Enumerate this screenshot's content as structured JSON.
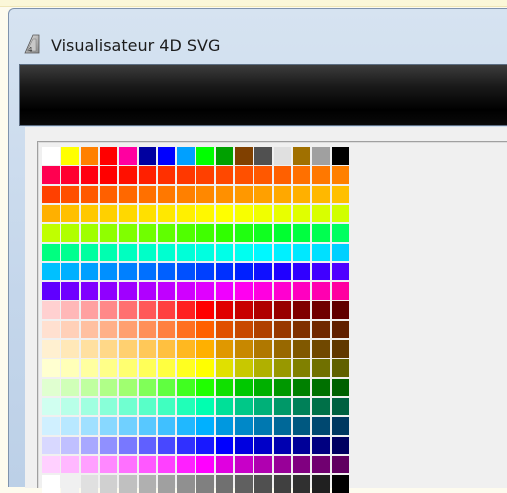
{
  "window": {
    "title": "Visualisateur 4D SVG",
    "icon": "4d-app-icon"
  },
  "palette": {
    "header_row": [
      "#ffffff",
      "#ffff00",
      "#ff8000",
      "#ff0000",
      "#ff00a0",
      "#0000a0",
      "#0000ff",
      "#00a0ff",
      "#00ff00",
      "#00a000",
      "#804000",
      "#505050",
      "#e0e0e0",
      "#a07000",
      "#a0a0a0",
      "#000000"
    ],
    "rows": [
      [
        "#ff0050",
        "#ff0030",
        "#ff0010",
        "#ff0000",
        "#ff1000",
        "#ff2000",
        "#ff3000",
        "#ff3800",
        "#ff4000",
        "#ff4800",
        "#ff5000",
        "#ff5800",
        "#ff6000",
        "#ff7000",
        "#ff7800",
        "#ff8000"
      ],
      [
        "#ff4000",
        "#ff5000",
        "#ff5800",
        "#ff6000",
        "#ff6800",
        "#ff7000",
        "#ff7800",
        "#ff8000",
        "#ff8800",
        "#ff9000",
        "#ff9800",
        "#ffa000",
        "#ffa800",
        "#ffb000",
        "#ffb800",
        "#ffc000"
      ],
      [
        "#ffb000",
        "#ffc000",
        "#ffc800",
        "#ffd000",
        "#ffd800",
        "#ffe000",
        "#ffe800",
        "#fff000",
        "#fff800",
        "#ffff00",
        "#f8ff00",
        "#f0ff00",
        "#e8ff00",
        "#e0ff00",
        "#d8ff00",
        "#d0ff00"
      ],
      [
        "#c0ff00",
        "#b0ff00",
        "#a0ff00",
        "#90ff00",
        "#80ff00",
        "#70ff00",
        "#60ff00",
        "#50ff00",
        "#40ff00",
        "#30ff00",
        "#20ff10",
        "#10ff20",
        "#00ff30",
        "#00ff40",
        "#00ff50",
        "#00ff60"
      ],
      [
        "#00ff80",
        "#00ff90",
        "#00ffa0",
        "#00ffb0",
        "#00ffc0",
        "#00ffc8",
        "#00ffd0",
        "#00ffd8",
        "#00ffe0",
        "#00ffe8",
        "#00fff0",
        "#00f8ff",
        "#00f0ff",
        "#00e8ff",
        "#00e0ff",
        "#00d0ff"
      ],
      [
        "#00c0ff",
        "#00b0ff",
        "#00a0ff",
        "#0090ff",
        "#0080ff",
        "#0070ff",
        "#0060ff",
        "#0050ff",
        "#0040ff",
        "#0030ff",
        "#0020ff",
        "#1010ff",
        "#2000ff",
        "#3000ff",
        "#4000ff",
        "#5000ff"
      ],
      [
        "#6000ff",
        "#7000ff",
        "#8000ff",
        "#9000ff",
        "#a000ff",
        "#b000ff",
        "#c000ff",
        "#d000ff",
        "#e000ff",
        "#f000ff",
        "#ff00f0",
        "#ff00e0",
        "#ff00d0",
        "#ff00c0",
        "#ff00b0",
        "#ff00a0"
      ],
      [
        "#ffd0d0",
        "#ffb8b8",
        "#ffa0a0",
        "#ff8888",
        "#ff7070",
        "#ff5858",
        "#ff4040",
        "#ff2020",
        "#ff0000",
        "#e00000",
        "#c80000",
        "#b00000",
        "#980000",
        "#800000",
        "#700000",
        "#600000"
      ],
      [
        "#ffe0d0",
        "#ffd0b8",
        "#ffc0a0",
        "#ffb088",
        "#ffa070",
        "#ff9058",
        "#ff8040",
        "#ff7020",
        "#ff6000",
        "#e05000",
        "#c84800",
        "#b04000",
        "#983800",
        "#803000",
        "#702800",
        "#602000"
      ],
      [
        "#fff0d0",
        "#ffe8b8",
        "#ffe0a0",
        "#ffd888",
        "#ffd070",
        "#ffc858",
        "#ffc040",
        "#ffb820",
        "#ffb000",
        "#e09800",
        "#c88800",
        "#b07800",
        "#986800",
        "#805800",
        "#704800",
        "#603800"
      ],
      [
        "#ffffd0",
        "#ffffb8",
        "#ffffa0",
        "#ffff88",
        "#ffff70",
        "#ffff58",
        "#ffff40",
        "#ffff20",
        "#ffff00",
        "#e0e000",
        "#c8c800",
        "#b0b000",
        "#989800",
        "#808000",
        "#707000",
        "#606000"
      ],
      [
        "#e0ffd0",
        "#d0ffb8",
        "#c0ffa0",
        "#b0ff88",
        "#a0ff70",
        "#80ff58",
        "#60ff40",
        "#40ff20",
        "#20ff00",
        "#10e000",
        "#00c800",
        "#00b000",
        "#009800",
        "#008000",
        "#007000",
        "#006000"
      ],
      [
        "#d0fff0",
        "#b8ffe8",
        "#a0ffe0",
        "#88ffd8",
        "#70ffd0",
        "#58ffc8",
        "#40ffc0",
        "#20ffb8",
        "#00ffb0",
        "#00e098",
        "#00c888",
        "#00b078",
        "#009868",
        "#008058",
        "#007048",
        "#006040"
      ],
      [
        "#d0f0ff",
        "#b8e8ff",
        "#a0e0ff",
        "#88d8ff",
        "#70d0ff",
        "#58c8ff",
        "#40c0ff",
        "#20b8ff",
        "#00b0ff",
        "#0098e0",
        "#0088c8",
        "#0078b0",
        "#006898",
        "#005880",
        "#004870",
        "#003860"
      ],
      [
        "#d8d8ff",
        "#c0c0ff",
        "#a8a8ff",
        "#9090ff",
        "#7878ff",
        "#6060ff",
        "#4848ff",
        "#3030ff",
        "#1818ff",
        "#0000ff",
        "#0000e0",
        "#0000c8",
        "#0000b0",
        "#000098",
        "#000080",
        "#000060"
      ],
      [
        "#ffd0ff",
        "#ffb8ff",
        "#ffa0ff",
        "#ff88ff",
        "#ff70ff",
        "#ff58ff",
        "#ff40ff",
        "#ff20ff",
        "#ff00ff",
        "#e000e0",
        "#c800c8",
        "#b000b0",
        "#980098",
        "#800080",
        "#700070",
        "#600060"
      ],
      [
        "#ffffff",
        "#f0f0f0",
        "#e0e0e0",
        "#d0d0d0",
        "#c0c0c0",
        "#b0b0b0",
        "#a0a0a0",
        "#909090",
        "#808080",
        "#707070",
        "#606060",
        "#505050",
        "#404040",
        "#303030",
        "#202020",
        "#000000"
      ]
    ]
  }
}
